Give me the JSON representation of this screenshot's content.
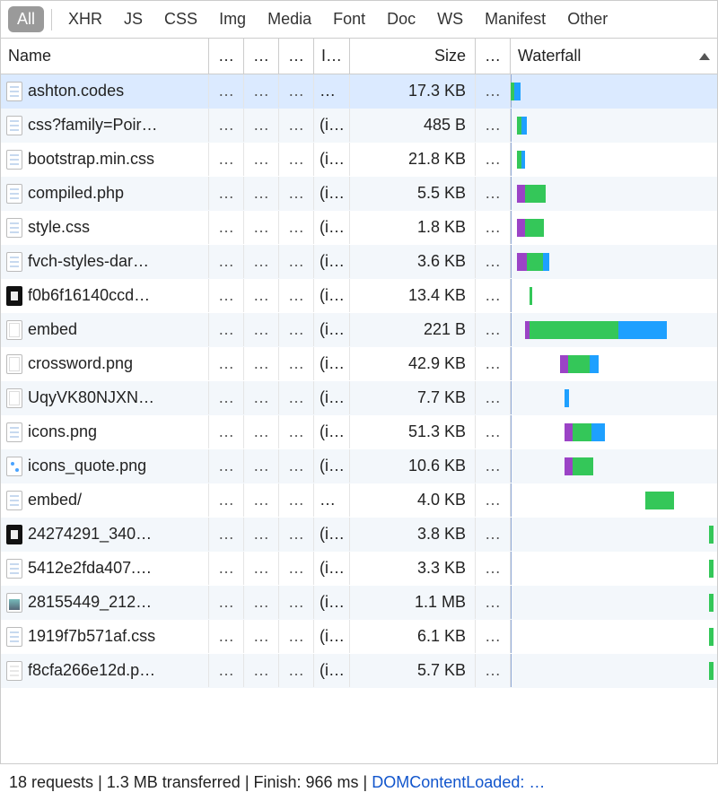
{
  "filters": {
    "all": "All",
    "xhr": "XHR",
    "js": "JS",
    "css": "CSS",
    "img": "Img",
    "media": "Media",
    "font": "Font",
    "doc": "Doc",
    "ws": "WS",
    "manifest": "Manifest",
    "other": "Other"
  },
  "headers": {
    "name": "Name",
    "generic": "…",
    "initiator": "I…",
    "size": "Size",
    "waterfall": "Waterfall"
  },
  "cells": {
    "ellipsis": "…",
    "initiator": "(i…"
  },
  "rows": [
    {
      "name": "ashton.codes",
      "size": "17.3 KB",
      "icon": "doc",
      "init": "…",
      "wf": {
        "start": 0,
        "segs": [
          [
            "green",
            2
          ],
          [
            "blue",
            4
          ]
        ]
      },
      "selected": true
    },
    {
      "name": "css?family=Poir…",
      "size": "485 B",
      "icon": "doc",
      "init": "(i…",
      "wf": {
        "start": 3,
        "segs": [
          [
            "green",
            3
          ],
          [
            "blue",
            3
          ]
        ]
      }
    },
    {
      "name": "bootstrap.min.css",
      "size": "21.8 KB",
      "icon": "doc",
      "init": "(i…",
      "wf": {
        "start": 3,
        "segs": [
          [
            "green",
            3
          ],
          [
            "blue",
            2
          ]
        ]
      }
    },
    {
      "name": "compiled.php",
      "size": "5.5 KB",
      "icon": "doc",
      "init": "(i…",
      "wf": {
        "start": 3,
        "segs": [
          [
            "wait",
            5
          ],
          [
            "green",
            13
          ]
        ]
      }
    },
    {
      "name": "style.css",
      "size": "1.8 KB",
      "icon": "doc",
      "init": "(i…",
      "wf": {
        "start": 3,
        "segs": [
          [
            "wait",
            5
          ],
          [
            "green",
            12
          ]
        ]
      }
    },
    {
      "name": "fvch-styles-dar…",
      "size": "3.6 KB",
      "icon": "doc",
      "init": "(i…",
      "wf": {
        "start": 3,
        "segs": [
          [
            "wait",
            6
          ],
          [
            "green",
            10
          ],
          [
            "blue",
            4
          ]
        ]
      }
    },
    {
      "name": "f0b6f16140ccd…",
      "size": "13.4 KB",
      "icon": "dark",
      "init": "(i…",
      "wf": {
        "start": 9,
        "segs": [
          [
            "green",
            2
          ]
        ]
      }
    },
    {
      "name": "embed",
      "size": "221 B",
      "icon": "img",
      "init": "(i…",
      "wf": {
        "start": 7,
        "segs": [
          [
            "wait",
            3
          ],
          [
            "green",
            55
          ],
          [
            "blue",
            30
          ]
        ]
      }
    },
    {
      "name": "crossword.png",
      "size": "42.9 KB",
      "icon": "img",
      "init": "(i…",
      "wf": {
        "start": 24,
        "segs": [
          [
            "wait",
            5
          ],
          [
            "green",
            13
          ],
          [
            "blue",
            6
          ]
        ]
      }
    },
    {
      "name": "UqyVK80NJXN…",
      "size": "7.7 KB",
      "icon": "img",
      "init": "(i…",
      "wf": {
        "start": 26,
        "segs": [
          [
            "blue",
            3
          ]
        ]
      }
    },
    {
      "name": "icons.png",
      "size": "51.3 KB",
      "icon": "doc",
      "init": "(i…",
      "wf": {
        "start": 26,
        "segs": [
          [
            "wait",
            5
          ],
          [
            "green",
            12
          ],
          [
            "blue",
            8
          ]
        ]
      }
    },
    {
      "name": "icons_quote.png",
      "size": "10.6 KB",
      "icon": "dots",
      "init": "(i…",
      "wf": {
        "start": 26,
        "segs": [
          [
            "wait",
            5
          ],
          [
            "green",
            13
          ]
        ]
      }
    },
    {
      "name": "embed/",
      "size": "4.0 KB",
      "icon": "doc",
      "init": "…",
      "wf": {
        "start": 65,
        "segs": [
          [
            "green",
            18
          ]
        ]
      }
    },
    {
      "name": "24274291_340…",
      "size": "3.8 KB",
      "icon": "dark",
      "init": "(i…",
      "wf": {
        "start": 96,
        "segs": [
          [
            "green",
            3
          ]
        ]
      }
    },
    {
      "name": "5412e2fda407.…",
      "size": "3.3 KB",
      "icon": "doc",
      "init": "(i…",
      "wf": {
        "start": 96,
        "segs": [
          [
            "green",
            3
          ]
        ]
      }
    },
    {
      "name": "28155449_212…",
      "size": "1.1 MB",
      "icon": "thumb",
      "init": "(i…",
      "wf": {
        "start": 96,
        "segs": [
          [
            "green",
            3
          ]
        ]
      }
    },
    {
      "name": "1919f7b571af.css",
      "size": "6.1 KB",
      "icon": "doc",
      "init": "(i…",
      "wf": {
        "start": 96,
        "segs": [
          [
            "green",
            3
          ]
        ]
      }
    },
    {
      "name": "f8cfa266e12d.p…",
      "size": "5.7 KB",
      "icon": "faded",
      "init": "(i…",
      "wf": {
        "start": 96,
        "segs": [
          [
            "green",
            3
          ]
        ]
      }
    }
  ],
  "summary": {
    "requests": "18 requests",
    "sep": " | ",
    "transferred": "1.3 MB transferred",
    "finish": "Finish: 966 ms",
    "dcl": "DOMContentLoaded: …"
  }
}
